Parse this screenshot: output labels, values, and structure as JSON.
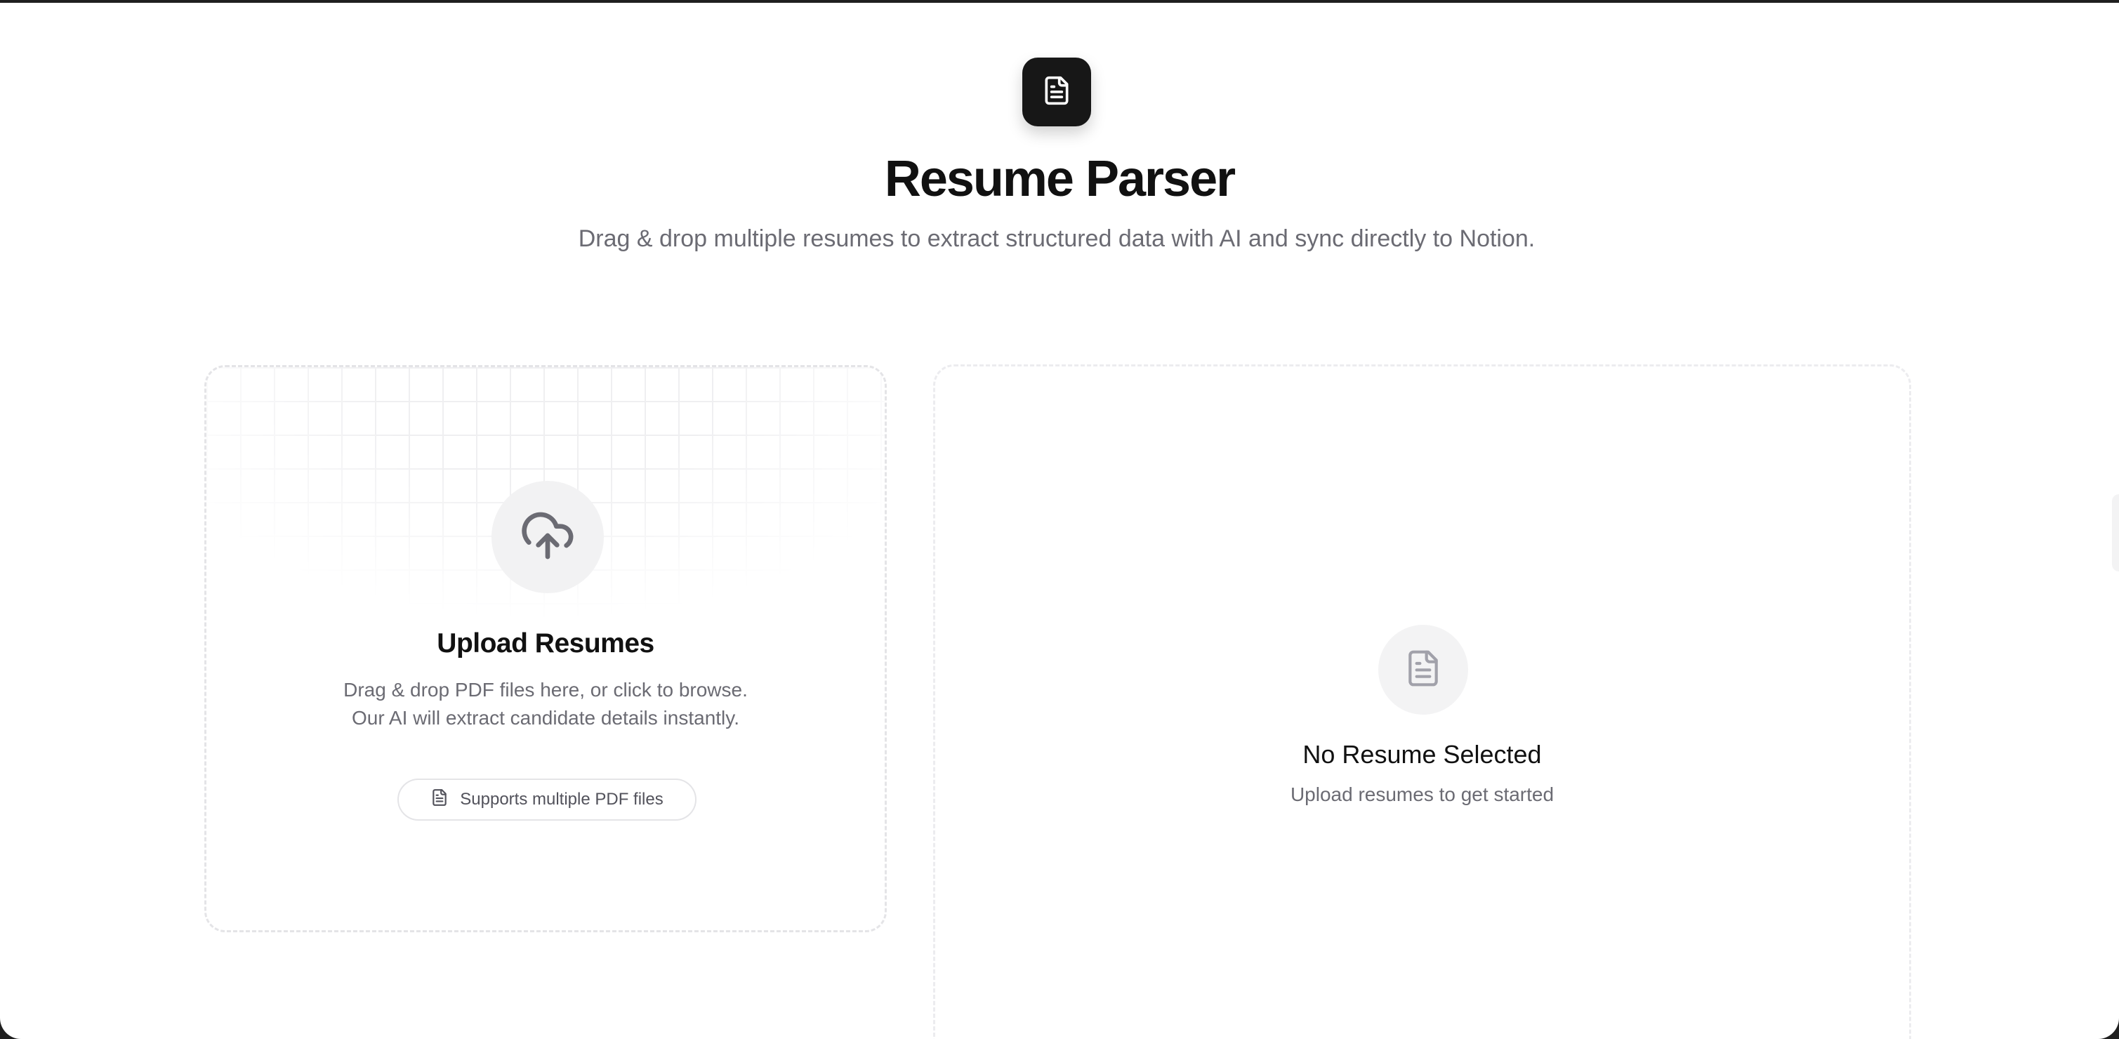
{
  "header": {
    "logo_icon": "document-icon",
    "title": "Resume Parser",
    "subtitle": "Drag & drop multiple resumes to extract structured data with AI and sync directly to Notion."
  },
  "upload": {
    "icon": "cloud-upload-icon",
    "title": "Upload Resumes",
    "description_line1": "Drag & drop PDF files here, or click to browse.",
    "description_line2": "Our AI will extract candidate details instantly.",
    "pill_icon": "file-icon",
    "pill_label": "Supports multiple PDF files"
  },
  "preview": {
    "icon": "document-icon",
    "title": "No Resume Selected",
    "subtitle": "Upload resumes to get started"
  },
  "colors": {
    "logo_bg": "#171717",
    "text_primary": "#111111",
    "text_muted": "#6b6b73",
    "border": "#e4e4e7"
  }
}
